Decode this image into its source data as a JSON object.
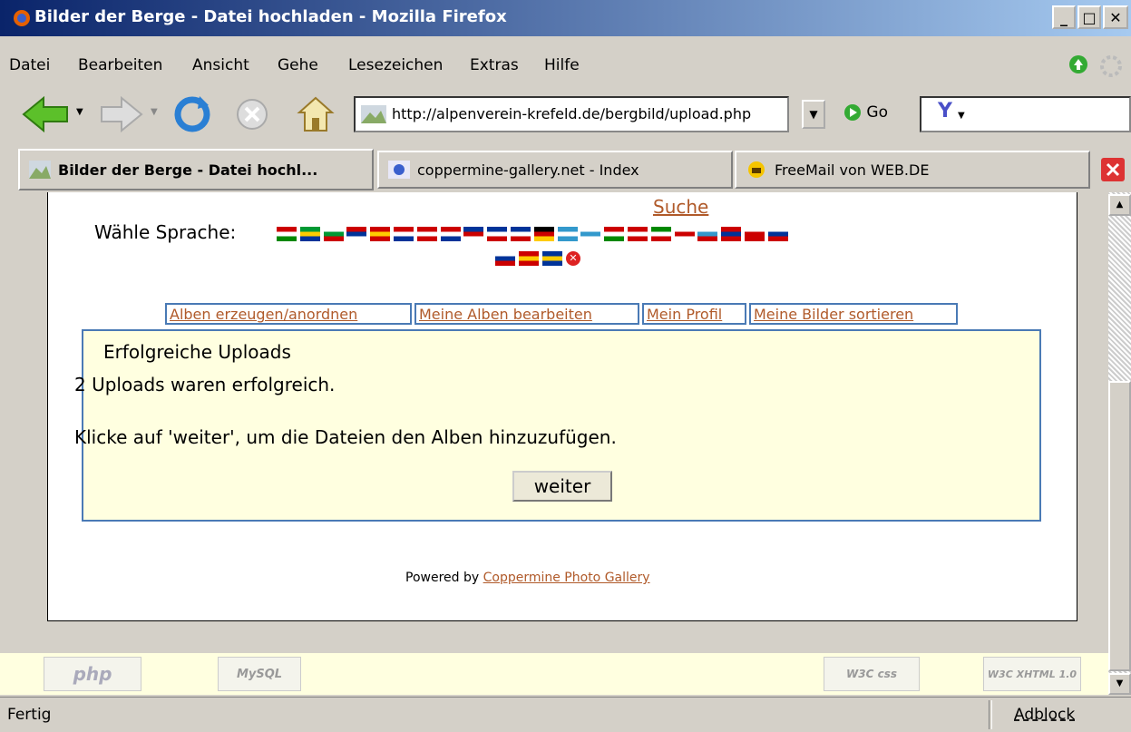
{
  "window": {
    "title": "Bilder der Berge - Datei hochladen - Mozilla Firefox"
  },
  "menu": {
    "items": [
      {
        "label": "Datei"
      },
      {
        "label": "Bearbeiten"
      },
      {
        "label": "Ansicht"
      },
      {
        "label": "Gehe"
      },
      {
        "label": "Lesezeichen"
      },
      {
        "label": "Extras"
      },
      {
        "label": "Hilfe"
      }
    ]
  },
  "toolbar": {
    "url": "http://alpenverein-krefeld.de/bergbild/upload.php",
    "go_label": "Go",
    "search_label": "Y"
  },
  "tabs": [
    {
      "label": "Bilder der Berge - Datei hochl..."
    },
    {
      "label": "coppermine-gallery.net - Index"
    },
    {
      "label": "FreeMail von WEB.DE"
    }
  ],
  "page": {
    "search_link": "Suche",
    "language_label": "Wähle Sprache:",
    "nav_links": [
      {
        "label": "Alben erzeugen/anordnen"
      },
      {
        "label": "Meine Alben bearbeiten"
      },
      {
        "label": "Mein Profil"
      },
      {
        "label": "Meine Bilder sortieren"
      }
    ],
    "box": {
      "title": "Erfolgreiche Uploads",
      "line1": "2 Uploads waren erfolgreich.",
      "line2": "Klicke auf 'weiter', um die Dateien den Alben hinzuzufügen.",
      "button": "weiter"
    },
    "powered_prefix": "Powered by",
    "powered_link": "Coppermine Photo Gallery"
  },
  "footer_badges": {
    "php": "php",
    "mysql": "MySQL",
    "css": "W3C css",
    "xhtml": "W3C XHTML 1.0"
  },
  "status": {
    "text": "Fertig",
    "adblock": "Adblock"
  }
}
